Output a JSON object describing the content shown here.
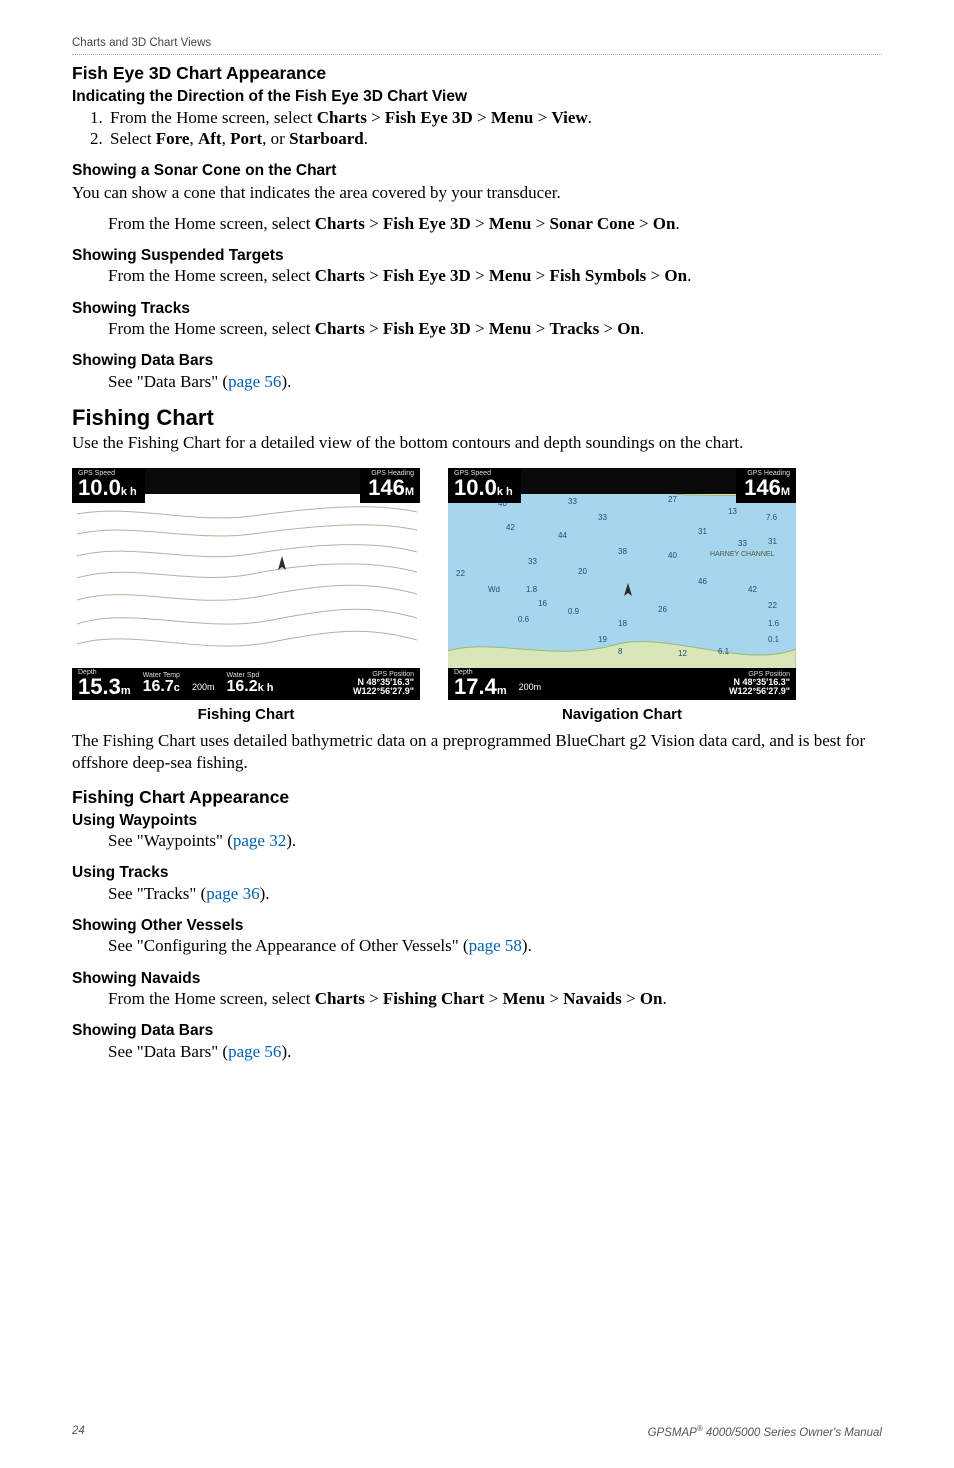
{
  "running_head": "Charts and 3D Chart Views",
  "sec_fisheye": {
    "title": "Fish Eye 3D Chart Appearance",
    "sub_direction": {
      "title": "Indicating the Direction of the Fish Eye 3D Chart View",
      "step1_prefix": "From the Home screen, select ",
      "step1_bold": "Charts > Fish Eye 3D > Menu > View",
      "step2_prefix": "Select ",
      "step2_bold": "Fore, Aft, Port, or Starboard"
    },
    "sub_sonarcone": {
      "title": "Showing a Sonar Cone on the Chart",
      "lead": "You can show a cone that indicates the area covered by your transducer.",
      "step_prefix": "From the Home screen, select ",
      "step_bold": "Charts > Fish Eye 3D > Menu > Sonar Cone > On"
    },
    "sub_suspended": {
      "title": "Showing Suspended Targets",
      "step_prefix": "From the Home screen, select ",
      "step_bold": "Charts > Fish Eye 3D > Menu > Fish Symbols > On"
    },
    "sub_tracks": {
      "title": "Showing Tracks",
      "step_prefix": "From the Home screen, select ",
      "step_bold": "Charts > Fish Eye 3D > Menu > Tracks > On"
    },
    "sub_databars": {
      "title": "Showing Data Bars",
      "text_prefix": "See \"Data Bars\" (",
      "link": "page 56",
      "text_suffix": ")."
    }
  },
  "sec_fishing_chart": {
    "title": "Fishing Chart",
    "intro": "Use the Fishing Chart for a detailed view of the bottom contours and depth soundings on the chart.",
    "body_after": "The Fishing Chart uses detailed bathymetric data on a preprogrammed BlueChart g2 Vision data card, and is best for offshore deep-sea fishing."
  },
  "figures": {
    "left": {
      "caption": "Fishing Chart",
      "gps_speed_label": "GPS Speed",
      "gps_speed": "10.0",
      "gps_speed_unit": "k h",
      "gps_heading_label": "GPS Heading",
      "gps_heading": "146",
      "gps_heading_unit": "M",
      "depth_label": "Depth",
      "depth": "15.3",
      "depth_unit": "m",
      "water_temp_label": "Water Temp",
      "water_temp": "16.7",
      "water_temp_unit": "c",
      "scale": "200m",
      "water_spd_label": "Water Spd",
      "water_spd": "16.2",
      "water_spd_unit": "k h",
      "gps_pos_label": "GPS Position",
      "gps_pos_n": "N  48°35'16.3\"",
      "gps_pos_w": "W122°56'27.9\""
    },
    "right": {
      "caption": "Navigation Chart",
      "gps_speed_label": "GPS Speed",
      "gps_speed": "10.0",
      "gps_speed_unit": "k h",
      "gps_heading_label": "GPS Heading",
      "gps_heading": "146",
      "gps_heading_unit": "M",
      "depth_label": "Depth",
      "depth": "17.4",
      "depth_unit": "m",
      "scale": "200m",
      "channel_label": "HARNEY CHANNEL",
      "gps_pos_label": "GPS Position",
      "gps_pos_n": "N  48°35'16.3\"",
      "gps_pos_w": "W122°56'27.9\"",
      "soundings": [
        "40",
        "33",
        "27",
        "13",
        "33",
        "7.6",
        "42",
        "44",
        "31",
        "33",
        "31",
        "33",
        "38",
        "40",
        "22",
        "20",
        "Wd",
        "1.8",
        "46",
        "42",
        "16",
        "0.6",
        "0.9",
        "22",
        "26",
        "18",
        "19",
        "1.6",
        "8",
        "0.1",
        "12",
        "6.1"
      ]
    }
  },
  "sec_fishing_appearance": {
    "title": "Fishing Chart Appearance",
    "waypoints": {
      "title": "Using Waypoints",
      "prefix": "See \"Waypoints\" (",
      "link": "page 32",
      "suffix": ")."
    },
    "tracks": {
      "title": "Using Tracks",
      "prefix": "See \"Tracks\" (",
      "link": "page 36",
      "suffix": ")."
    },
    "vessels": {
      "title": "Showing Other Vessels",
      "prefix": "See \"Configuring the Appearance of Other Vessels\" (",
      "link": "page 58",
      "suffix": ")."
    },
    "navaids": {
      "title": "Showing Navaids",
      "step_prefix": "From the Home screen, select ",
      "step_bold": "Charts > Fishing Chart > Menu > Navaids > On"
    },
    "databars": {
      "title": "Showing Data Bars",
      "prefix": "See \"Data Bars\" (",
      "link": "page 56",
      "suffix": ")."
    }
  },
  "footer": {
    "page": "24",
    "product_left": "GPSMAP",
    "product_right": " 4000/5000 Series Owner's Manual"
  }
}
